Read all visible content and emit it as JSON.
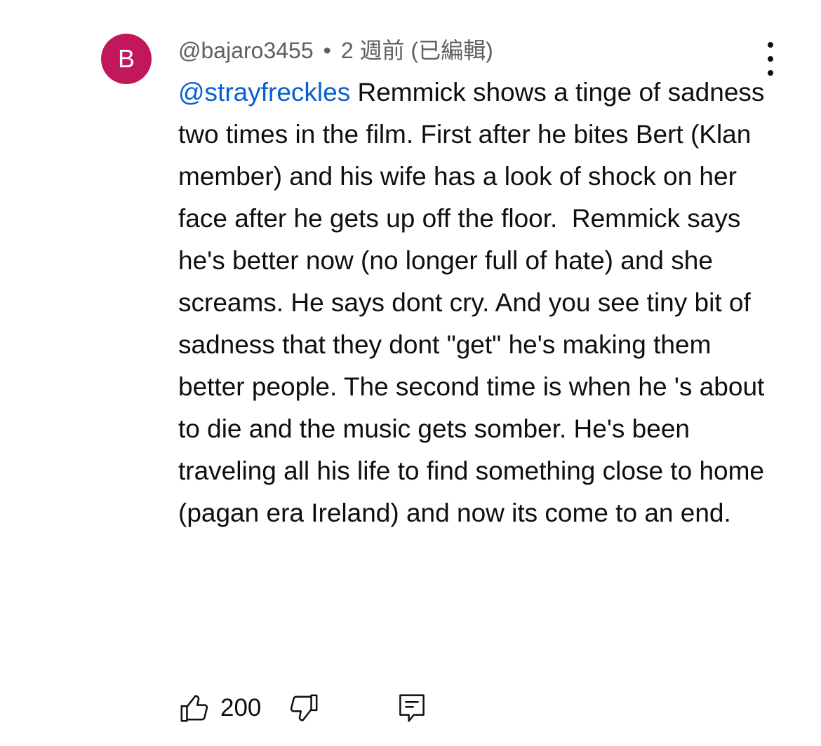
{
  "comment": {
    "avatar_letter": "B",
    "avatar_color": "#c2185b",
    "author": "@bajaro3455",
    "separator": "•",
    "time": "2 週前 (已編輯)",
    "mention": "@strayfreckles",
    "text": " Remmick shows a tinge of sadness two times in the film. First after he bites Bert (Klan member) and his wife has a look of shock on her face after he gets up off the floor.  Remmick says he's better now (no longer full of hate) and she screams. He says dont cry. And you see tiny bit of sadness that they dont \"get\" he's making them better people. The second time is when he 's about to die and the music gets somber. He's been traveling all his life to find something close to home (pagan era Ireland) and now its come to an end.",
    "like_count": "200"
  },
  "icons": {
    "menu": "more-vertical-icon",
    "like": "thumbs-up-icon",
    "dislike": "thumbs-down-icon",
    "reply": "reply-comment-icon"
  },
  "colors": {
    "mention": "#065fd4",
    "meta_text": "#606060",
    "text": "#0f0f0f"
  }
}
